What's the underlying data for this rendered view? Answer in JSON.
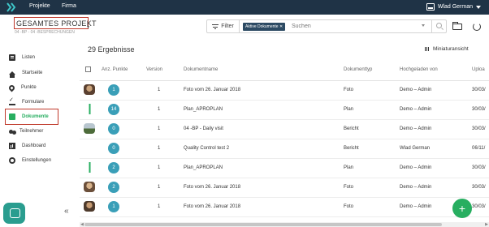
{
  "topbar": {
    "nav_projekte": "Projekte",
    "nav_firma": "Firma",
    "user_name": "Wlad German"
  },
  "project": {
    "title": "GESAMTES PROJEKT",
    "subtitle": "04 -BP - 04 -BESPRECHUNGEN"
  },
  "filter": {
    "filter_label": "Filter",
    "chip_label": "Aktive Dokumente ✕",
    "search_placeholder": "Suchen"
  },
  "sidebar": {
    "items": [
      {
        "label": "Listen",
        "icon": "list-icon"
      },
      {
        "label": "Startseite",
        "icon": "home-icon"
      },
      {
        "label": "Punkte",
        "icon": "map-pin-icon"
      },
      {
        "label": "Formulare",
        "icon": "checklist-icon"
      },
      {
        "label": "Dokumente",
        "icon": "document-icon"
      },
      {
        "label": "Teilnehmer",
        "icon": "team-icon"
      },
      {
        "label": "Dashboard",
        "icon": "dashboard-icon"
      },
      {
        "label": "Einstellungen",
        "icon": "gear-icon"
      }
    ],
    "collapse_label": "«"
  },
  "main": {
    "results": "29 Ergebnisse",
    "miniatur": "Miniaturansicht",
    "columns": {
      "points": "Anz. Punkte",
      "version": "Version",
      "name": "Dokumentname",
      "type": "Dokumenttyp",
      "uploader": "Hochgeladen von",
      "upload": "Uploa"
    },
    "rows": [
      {
        "points": "1",
        "version": "1",
        "name": "Foto vom 26. Januar 2018",
        "type": "Foto",
        "uploader": "Demo – Admin",
        "date": "30/03/"
      },
      {
        "points": "14",
        "version": "1",
        "name": "Plan_APROPLAN",
        "type": "Plan",
        "uploader": "Demo – Admin",
        "date": "30/03/"
      },
      {
        "points": "0",
        "version": "1",
        "name": "04 -BP - Daily visit",
        "type": "Bericht",
        "uploader": "Demo – Admin",
        "date": "30/03/"
      },
      {
        "points": "0",
        "version": "1",
        "name": "Quality Control test 2",
        "type": "Bericht",
        "uploader": "Wlad German",
        "date": "06/11/"
      },
      {
        "points": "2",
        "version": "1",
        "name": "Plan_APROPLAN",
        "type": "Plan",
        "uploader": "Demo – Admin",
        "date": "30/03/"
      },
      {
        "points": "2",
        "version": "1",
        "name": "Foto vom 26. Januar 2018",
        "type": "Foto",
        "uploader": "Demo – Admin",
        "date": "30/03/"
      },
      {
        "points": "1",
        "version": "1",
        "name": "Foto vom 26. Januar 2018",
        "type": "Foto",
        "uploader": "Demo – Admin",
        "date": "30/03/"
      }
    ]
  },
  "fab_label": "+",
  "colors": {
    "topbar": "#1f3346",
    "accent_green": "#27ae60",
    "badge_blue": "#3a9fb8",
    "highlight_red": "#c0392b"
  }
}
